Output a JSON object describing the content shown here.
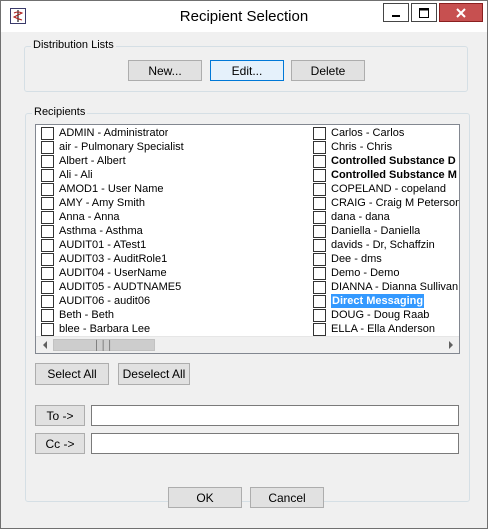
{
  "window": {
    "title": "Recipient Selection",
    "icon": "caduceus-icon",
    "controls": [
      "minimize-icon",
      "maximize-icon",
      "close-icon"
    ]
  },
  "distribution_lists": {
    "label": "Distribution Lists",
    "buttons": {
      "new": "New...",
      "edit": "Edit...",
      "delete": "Delete"
    }
  },
  "recipients": {
    "label": "Recipients",
    "left_column": [
      "ADMIN  - Administrator",
      "air  - Pulmonary Specialist",
      "Albert  - Albert",
      "Ali  - Ali",
      "AMOD1  - User Name",
      "AMY  - Amy Smith",
      "Anna  - Anna",
      "Asthma  - Asthma",
      "AUDIT01  - ATest1",
      "AUDIT03  - AuditRole1",
      "AUDIT04  - UserName",
      "AUDIT05  - AUDTNAME5",
      "AUDIT06  - audit06",
      "Beth  - Beth",
      "blee  - Barbara Lee"
    ],
    "right_column": [
      "Carlos  - Carlos",
      "Chris  - Chris",
      "Controlled Substance D",
      "Controlled Substance M",
      "COPELAND  - copeland",
      "CRAIG  - Craig M Peterson",
      "dana  - dana",
      "Daniella  - Daniella",
      "davids  - Dr, Schaffzin",
      "Dee  - dms",
      "Demo  - Demo",
      "DIANNA  - Dianna Sullivan",
      "Direct Messaging",
      "DOUG  - Doug Raab",
      "ELLA  - Ella Anderson"
    ],
    "select_all": "Select All",
    "deselect_all": "Deselect All"
  },
  "addressing": {
    "to_label": "To ->",
    "to_value": "",
    "cc_label": "Cc ->",
    "cc_value": ""
  },
  "footer": {
    "ok": "OK",
    "cancel": "Cancel"
  }
}
